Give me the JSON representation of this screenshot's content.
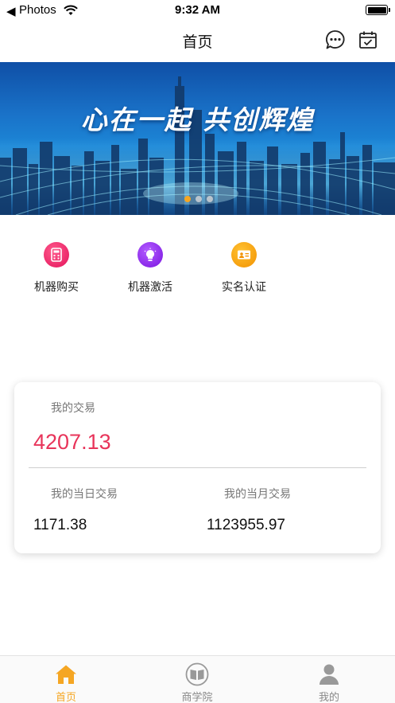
{
  "status_bar": {
    "back_glyph": "◀",
    "app": "Photos",
    "time": "9:32 AM"
  },
  "nav": {
    "title": "首页",
    "chat_icon": "chat-bubble-icon",
    "calendar_icon": "calendar-check-icon"
  },
  "banner": {
    "title": "心在一起 共创辉煌",
    "active_index": 0,
    "dot_count": 3
  },
  "quick_actions": [
    {
      "label": "机器购买",
      "icon": "calculator-icon",
      "color": "#e91e63"
    },
    {
      "label": "机器激活",
      "icon": "lightbulb-icon",
      "color": "#8e24e6"
    },
    {
      "label": "实名认证",
      "icon": "id-card-icon",
      "color": "#f7a600"
    }
  ],
  "stats": {
    "total_label": "我的交易",
    "total_value": "4207.13",
    "daily_label": "我的当日交易",
    "daily_value": "1171.38",
    "monthly_label": "我的当月交易",
    "monthly_value": "1123955.97"
  },
  "tabbar": {
    "items": [
      {
        "label": "首页",
        "icon": "home-icon",
        "active": true
      },
      {
        "label": "商学院",
        "icon": "book-icon",
        "active": false
      },
      {
        "label": "我的",
        "icon": "user-icon",
        "active": false
      }
    ]
  },
  "colors": {
    "accent": "#f5a623",
    "highlight": "#e8345a"
  }
}
